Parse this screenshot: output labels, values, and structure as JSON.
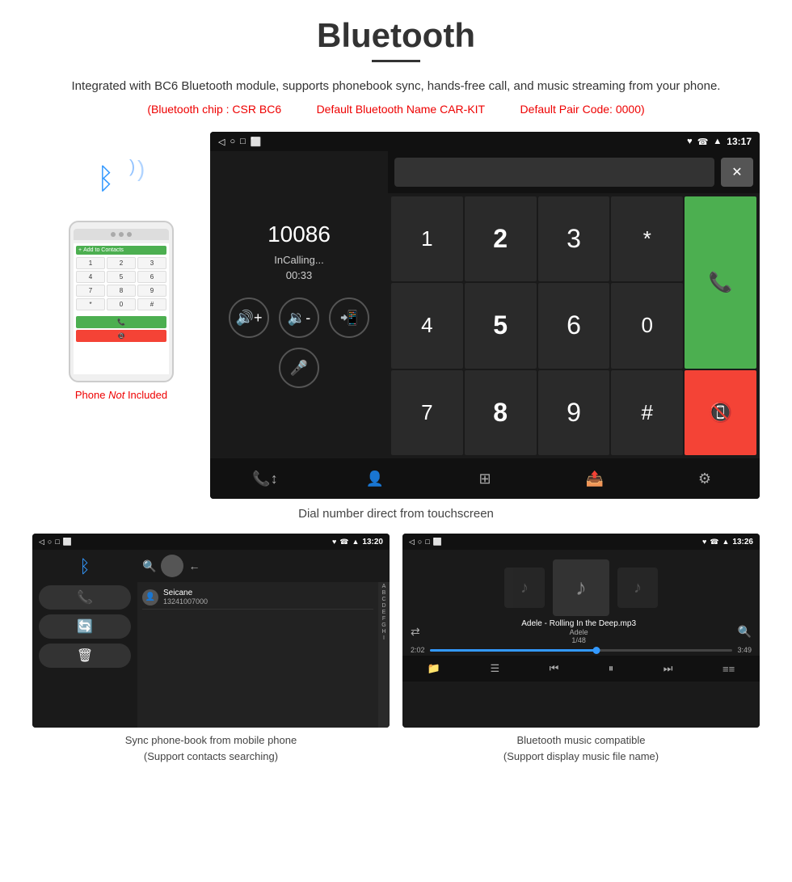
{
  "page": {
    "title": "Bluetooth",
    "description": "Integrated with BC6 Bluetooth module, supports phonebook sync, hands-free call, and music streaming from your phone.",
    "specs": {
      "chip": "(Bluetooth chip : CSR BC6",
      "name": "Default Bluetooth Name CAR-KIT",
      "code": "Default Pair Code: 0000)"
    }
  },
  "main_screen": {
    "status_bar": {
      "icons": "♥ ☎ ▲",
      "time": "13:17"
    },
    "dial_number": "10086",
    "status": "InCalling...",
    "timer": "00:33",
    "keypad": [
      "1",
      "2",
      "3",
      "*",
      "4",
      "5",
      "6",
      "0",
      "7",
      "8",
      "9",
      "#"
    ],
    "caption": "Dial number direct from touchscreen"
  },
  "contacts_screen": {
    "status_bar": {
      "time": "13:20"
    },
    "contact_name": "Seicane",
    "contact_number": "13241007000",
    "alphabet": [
      "A",
      "B",
      "C",
      "D",
      "E",
      "F",
      "G",
      "H",
      "I"
    ],
    "caption_line1": "Sync phone-book from mobile phone",
    "caption_line2": "(Support contacts searching)"
  },
  "music_screen": {
    "status_bar": {
      "time": "13:26"
    },
    "song_title": "Adele - Rolling In the Deep.mp3",
    "artist": "Adele",
    "track_info": "1/48",
    "time_current": "2:02",
    "time_total": "3:49",
    "progress_percent": 55,
    "caption_line1": "Bluetooth music compatible",
    "caption_line2": "(Support display music file name)"
  },
  "phone_image": {
    "label": "Phone Not Included",
    "keys": [
      "1",
      "2",
      "3",
      "4",
      "5",
      "6",
      "7",
      "8",
      "9",
      "*",
      "0",
      "#"
    ]
  },
  "icons": {
    "bluetooth": "ᛒ",
    "phone_call": "📞",
    "end_call": "📵",
    "volume_up": "🔊",
    "volume_down": "🔉",
    "transfer": "📲",
    "mic": "🎤",
    "back": "◁",
    "home": "○",
    "recent": "□",
    "music_note": "♪",
    "shuffle": "⇄",
    "prev": "⏮",
    "play_pause": "⏸",
    "next": "⏭",
    "equalizer": "≡",
    "folder": "📁",
    "list": "☰",
    "search": "🔍"
  }
}
